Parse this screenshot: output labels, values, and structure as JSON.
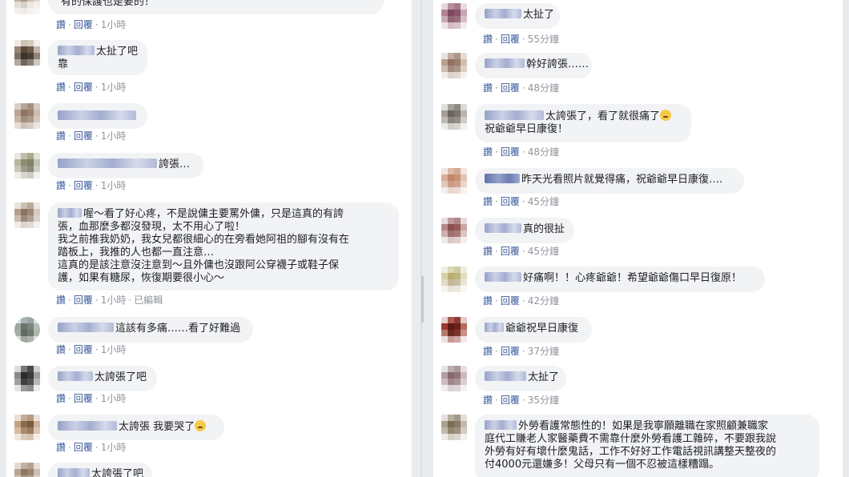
{
  "labels": {
    "like": "讚",
    "reply": "回覆",
    "edited": "已編輯"
  },
  "left_comments": [
    {
      "lines": [
        "有的保護也是要的！"
      ],
      "time": "1小時",
      "edited": false
    },
    {
      "lines": [
        "太扯了吧",
        "靠"
      ],
      "time": "1小時",
      "edited": false
    },
    {
      "lines": [
        ""
      ],
      "time": "1小時",
      "edited": false
    },
    {
      "lines": [
        "誇張…"
      ],
      "time": "1小時",
      "edited": false
    },
    {
      "lines": [
        "喔～看了好心疼，不是說傭主要罵外傭，只是這真的有誇",
        "張，血那麼多都沒發現，太不用心了啦！",
        "我之前推我奶奶，我女兒都很細心的在旁看她阿祖的腳有沒有在",
        "踏板上，我推的人也都一直注意…",
        "這真的是該注意沒注意到～且外傭也沒跟阿公穿襪子或鞋子保",
        "護，如果有糖尿，恢復期要很小心～"
      ],
      "time": "1小時",
      "edited": true
    },
    {
      "lines": [
        "這該有多痛……看了好難過"
      ],
      "time": "1小時",
      "edited": false
    },
    {
      "lines": [
        "太誇張了吧"
      ],
      "time": "1小時",
      "edited": false
    },
    {
      "lines": [
        "太誇張 我要哭了"
      ],
      "time": "1小時",
      "edited": false
    },
    {
      "lines": [
        "太誇張了吧"
      ],
      "time": "",
      "edited": false
    }
  ],
  "right_comments": [
    {
      "lines": [
        "太扯了"
      ],
      "time": "55分鐘"
    },
    {
      "lines": [
        "幹好誇張……"
      ],
      "time": "48分鐘"
    },
    {
      "lines": [
        "太誇張了，看了就很痛了",
        "祝爺爺早日康復！"
      ],
      "time": "48分鐘"
    },
    {
      "lines": [
        "昨天光看照片就覺得痛，祝爺爺早日康復…."
      ],
      "time": "45分鐘"
    },
    {
      "lines": [
        "真的很扯"
      ],
      "time": "45分鐘"
    },
    {
      "lines": [
        "好痛啊！！心疼爺爺！希望爺爺傷口早日復原！"
      ],
      "time": "42分鐘"
    },
    {
      "lines": [
        "爺爺祝早日康復"
      ],
      "time": "37分鐘"
    },
    {
      "lines": [
        "太扯了"
      ],
      "time": "35分鐘"
    },
    {
      "lines": [
        "外勞看護常態性的！如果是我寧願離職在家照顧兼職家",
        "庭代工賺老人家醫藥費不需靠什麼外勞看護工雜碎，不要跟我說",
        "外勞有好有壞什麼鬼話，工作不好好工作電話視訊講整天整夜的",
        "付4000元還嫌多！父母只有一個不忍被這樣糟蹋。"
      ],
      "time": ""
    }
  ]
}
